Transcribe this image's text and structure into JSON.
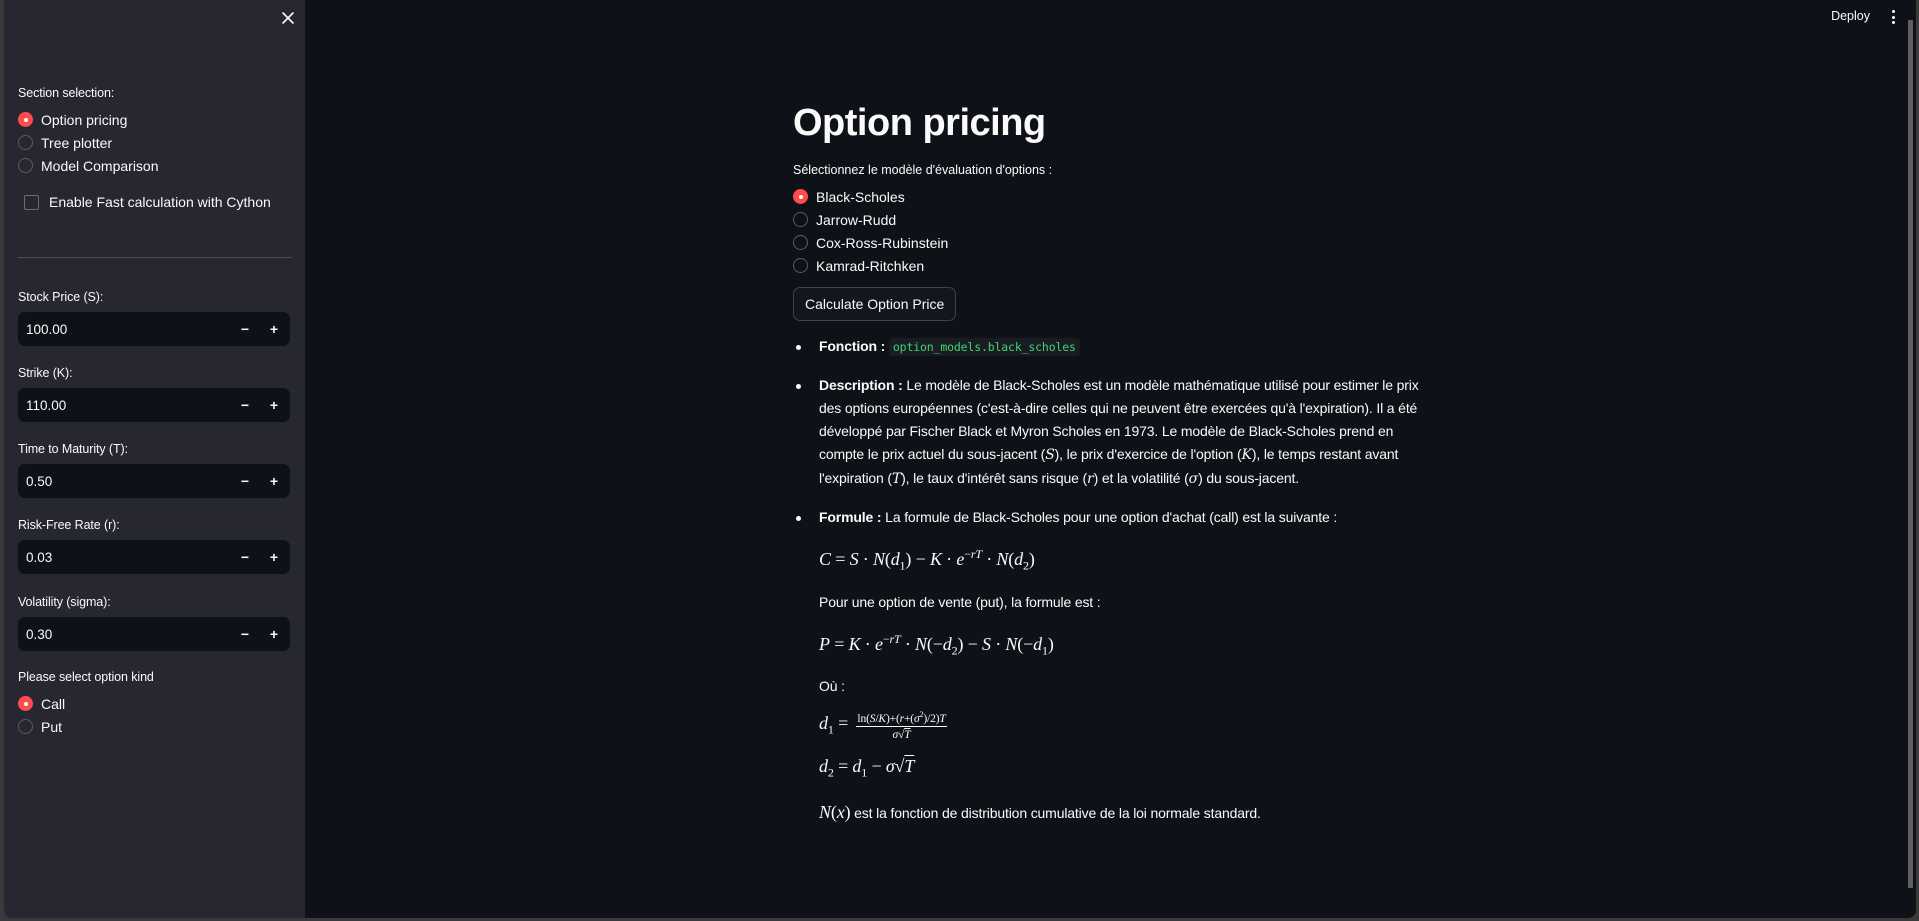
{
  "sidebar": {
    "section_label": "Section selection:",
    "sections": [
      {
        "label": "Option pricing",
        "checked": true
      },
      {
        "label": "Tree plotter",
        "checked": false
      },
      {
        "label": "Model Comparison",
        "checked": false
      }
    ],
    "cython_label": "Enable Fast calculation with Cython",
    "cython_checked": false,
    "inputs": [
      {
        "label": "Stock Price (S):",
        "value": "100.00"
      },
      {
        "label": "Strike (K):",
        "value": "110.00"
      },
      {
        "label": "Time to Maturity (T):",
        "value": "0.50"
      },
      {
        "label": "Risk-Free Rate (r):",
        "value": "0.03"
      },
      {
        "label": "Volatility (sigma):",
        "value": "0.30"
      }
    ],
    "stepper_minus": "−",
    "stepper_plus": "+",
    "kind_label": "Please select option kind",
    "kinds": [
      {
        "label": "Call",
        "checked": true
      },
      {
        "label": "Put",
        "checked": false
      }
    ],
    "close_icon": "close-icon"
  },
  "header": {
    "deploy_label": "Deploy",
    "menu_icon": "kebab-menu-icon"
  },
  "main": {
    "title": "Option pricing",
    "model_label": "Sélectionnez le modèle d'évaluation d'options :",
    "models": [
      {
        "label": "Black-Scholes",
        "checked": true
      },
      {
        "label": "Jarrow-Rudd",
        "checked": false
      },
      {
        "label": "Cox-Ross-Rubinstein",
        "checked": false
      },
      {
        "label": "Kamrad-Ritchken",
        "checked": false
      }
    ],
    "calculate_label": "Calculate Option Price",
    "fonction": {
      "key": "Fonction :",
      "code": "option_models.black_scholes"
    },
    "description": {
      "key": "Description :",
      "p1": " Le modèle de Black-Scholes est un modèle mathématique utilisé pour estimer le prix des options européennes (c'est-à-dire celles qui ne peuvent être exercées qu'à l'expiration). Il a été développé par Fischer Black et Myron Scholes en 1973. Le modèle de Black-Scholes prend en compte le prix actuel du sous-jacent (",
      "v1": "S",
      "p2": "), le prix d'exercice de l'option (",
      "v2": "K",
      "p3": "), le temps restant avant l'expiration (",
      "v3": "T",
      "p4": "), le taux d'intérêt sans risque (",
      "v4": "r",
      "p5": ") et la volatilité (",
      "v5": "σ",
      "p6": ") du sous-jacent."
    },
    "formule": {
      "key": "Formule :",
      "intro": " La formule de Black-Scholes pour une option d'achat (call) est la suivante :",
      "call_formula": "C = S · N(d₁) − K · e^(−rT) · N(d₂)",
      "put_intro": "Pour une option de vente (put), la formule est :",
      "put_formula": "P = K · e^(−rT) · N(−d₂) − S · N(−d₁)",
      "where": "Où :",
      "d1_formula": "d₁ = (ln(S/K) + (r + (σ²)/2)T) / (σ√T)",
      "d2_formula": "d₂ = d₁ − σ√T",
      "nx_var": "N(x)",
      "nx_text": " est la fonction de distribution cumulative de la loi normale standard."
    }
  },
  "colors": {
    "accent": "#ff4b4b",
    "sidebar_bg": "#262730",
    "main_bg": "#0e1117",
    "code_green": "#3dd56d"
  }
}
